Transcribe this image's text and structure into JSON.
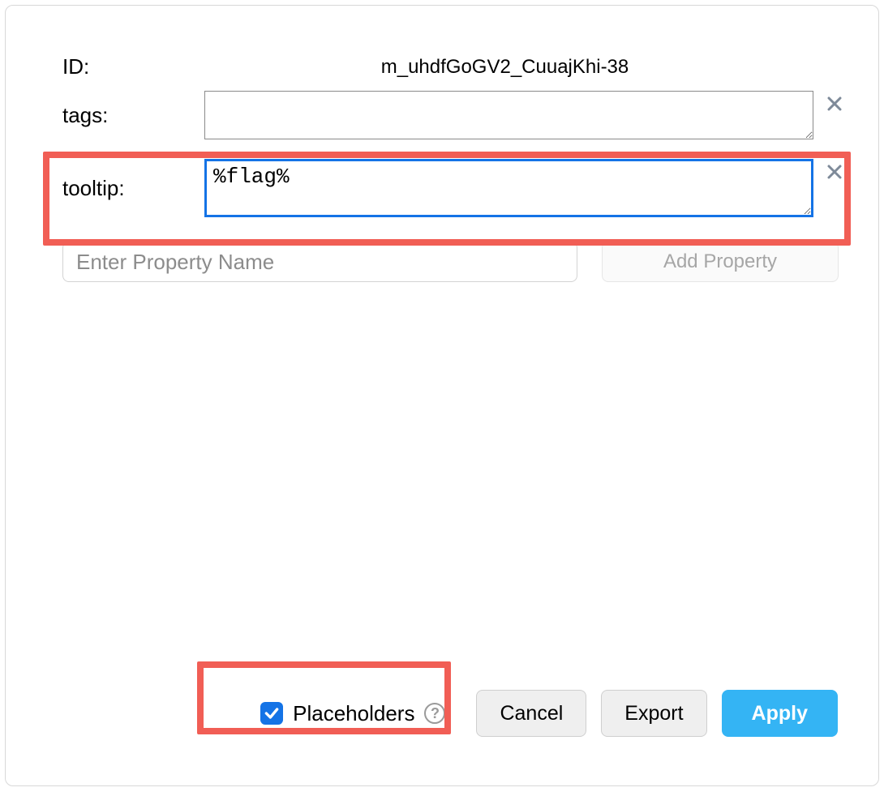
{
  "fields": {
    "id": {
      "label": "ID:",
      "value": "m_uhdfGoGV2_CuuajKhi-38"
    },
    "tags": {
      "label": "tags:",
      "value": ""
    },
    "tooltip": {
      "label": "tooltip:",
      "value": "%flag%"
    }
  },
  "addProperty": {
    "placeholder": "Enter Property Name",
    "button": "Add Property"
  },
  "footer": {
    "placeholdersLabel": "Placeholders",
    "placeholdersChecked": true,
    "cancel": "Cancel",
    "export": "Export",
    "apply": "Apply"
  }
}
